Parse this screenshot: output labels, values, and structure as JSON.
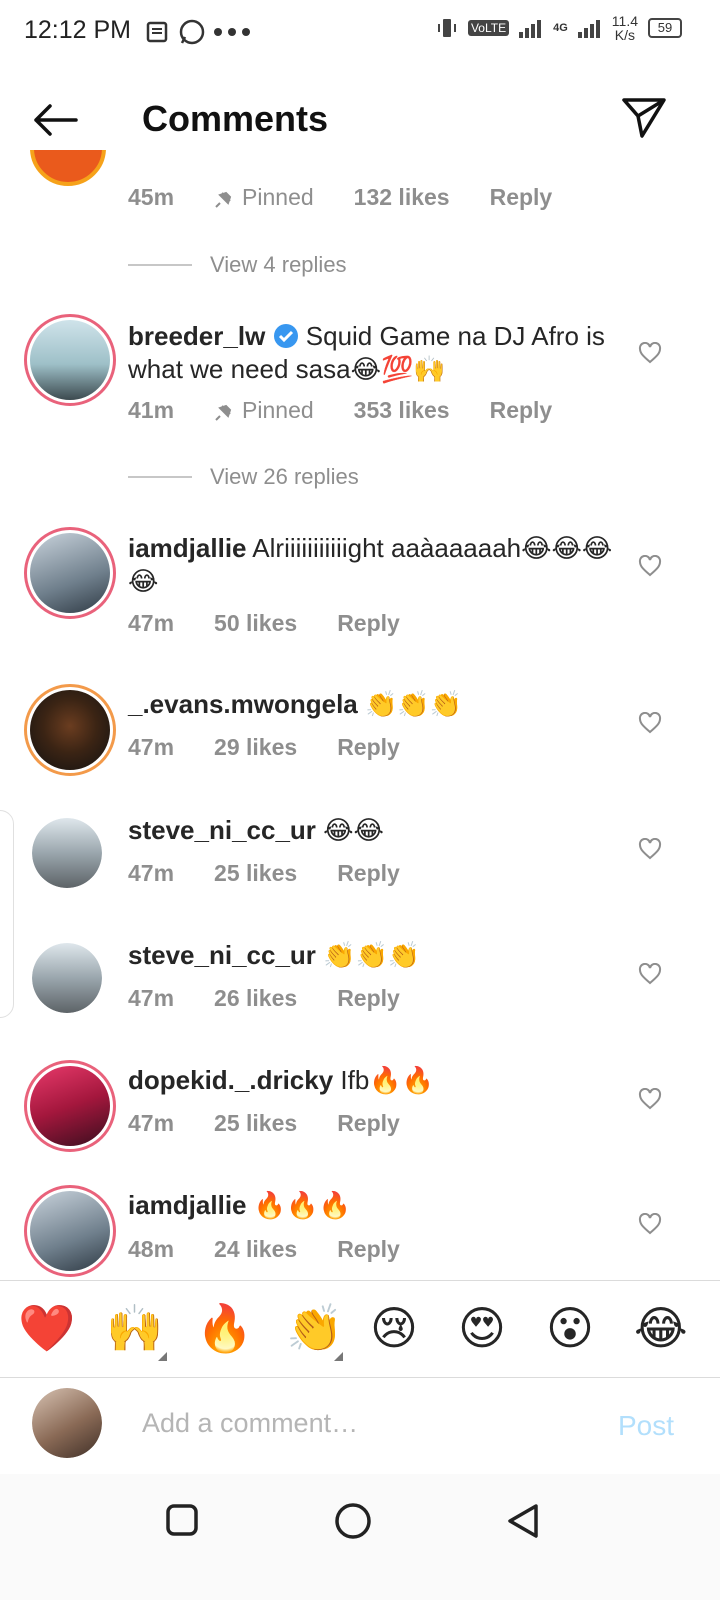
{
  "status_bar": {
    "time": "12:12 PM",
    "network_label": "VoLTE",
    "net_gen": "4G",
    "speed": "11.4",
    "speed_unit": "K/s",
    "battery": "59"
  },
  "header": {
    "title": "Comments"
  },
  "comments": [
    {
      "time": "45m",
      "pinned": "Pinned",
      "likes": "132 likes",
      "reply": "Reply",
      "view_replies": "View 4 replies"
    },
    {
      "username": "breeder_lw",
      "text": "Squid Game na DJ Afro is what we need sasa😂💯🙌",
      "time": "41m",
      "pinned": "Pinned",
      "likes": "353 likes",
      "reply": "Reply",
      "view_replies": "View 26 replies"
    },
    {
      "username": "iamdjallie",
      "text": "Alriiiiiiiiiiight aaàaaaaah😂😂😂😂",
      "time": "47m",
      "likes": "50 likes",
      "reply": "Reply"
    },
    {
      "username": "_.evans.mwongela",
      "text": "👏👏👏",
      "time": "47m",
      "likes": "29 likes",
      "reply": "Reply"
    },
    {
      "username": "steve_ni_cc_ur",
      "text": "😂😂",
      "time": "47m",
      "likes": "25 likes",
      "reply": "Reply"
    },
    {
      "username": "steve_ni_cc_ur",
      "text": "👏👏👏",
      "time": "47m",
      "likes": "26 likes",
      "reply": "Reply"
    },
    {
      "username": "dopekid._.dricky",
      "text": "Ifb🔥🔥",
      "time": "47m",
      "likes": "25 likes",
      "reply": "Reply"
    },
    {
      "username": "iamdjallie",
      "text": "🔥🔥🔥",
      "time": "48m",
      "likes": "24 likes",
      "reply": "Reply"
    }
  ],
  "emoji_bar": [
    "❤️",
    "🙌",
    "🔥",
    "👏",
    "😢",
    "😍",
    "😮",
    "😂"
  ],
  "composer": {
    "placeholder": "Add a comment…",
    "post_label": "Post"
  },
  "colors": {
    "accent": "#0095f6",
    "post_disabled": "#b2dffc",
    "ring": "#e9627b",
    "meta": "#8e8e8e"
  },
  "icons": {
    "back": "arrow-left-icon",
    "send": "paper-plane-icon",
    "like": "heart-outline-icon",
    "verified": "verified-badge-icon",
    "pin": "pin-icon"
  }
}
